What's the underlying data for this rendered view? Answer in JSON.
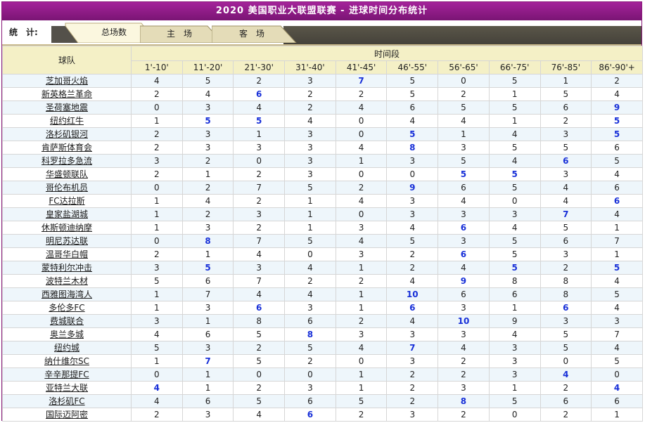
{
  "title": "2020 美国职业大联盟联赛 - 进球时间分布统计",
  "stats_label": "统　计:",
  "tabs": [
    {
      "label": "总场数",
      "active": true
    },
    {
      "label": "主　场",
      "active": false
    },
    {
      "label": "客　场",
      "active": false
    }
  ],
  "table": {
    "team_header": "球队",
    "period_header": "时间段",
    "periods": [
      "1'-10'",
      "11'-20'",
      "21'-30'",
      "31'-40'",
      "41'-45'",
      "46'-55'",
      "56'-65'",
      "66'-75'",
      "76'-85'",
      "86'-90'+"
    ],
    "rows": [
      {
        "team": "芝加哥火焰",
        "values": [
          4,
          5,
          2,
          3,
          7,
          5,
          0,
          5,
          1,
          2
        ],
        "highlight": [
          4
        ]
      },
      {
        "team": "新英格兰革命",
        "values": [
          2,
          4,
          6,
          2,
          2,
          5,
          2,
          1,
          5,
          4
        ],
        "highlight": [
          2
        ]
      },
      {
        "team": "圣荷塞地震",
        "values": [
          0,
          3,
          4,
          2,
          4,
          6,
          5,
          5,
          6,
          9
        ],
        "highlight": [
          9
        ]
      },
      {
        "team": "纽约红牛",
        "values": [
          1,
          5,
          5,
          4,
          0,
          4,
          4,
          1,
          2,
          5
        ],
        "highlight": [
          1,
          2,
          9
        ]
      },
      {
        "team": "洛杉矶银河",
        "values": [
          2,
          3,
          1,
          3,
          0,
          5,
          1,
          4,
          3,
          5
        ],
        "highlight": [
          5,
          9
        ]
      },
      {
        "team": "肯萨斯体育会",
        "values": [
          2,
          3,
          3,
          3,
          4,
          8,
          3,
          5,
          5,
          6
        ],
        "highlight": [
          5
        ]
      },
      {
        "team": "科罗拉多急流",
        "values": [
          3,
          2,
          0,
          3,
          1,
          3,
          5,
          4,
          6,
          5
        ],
        "highlight": [
          8
        ]
      },
      {
        "team": "华盛顿联队",
        "values": [
          2,
          1,
          2,
          3,
          0,
          0,
          5,
          5,
          3,
          4
        ],
        "highlight": [
          6,
          7
        ]
      },
      {
        "team": "哥伦布机员",
        "values": [
          0,
          2,
          7,
          5,
          2,
          9,
          6,
          5,
          4,
          6
        ],
        "highlight": [
          5
        ]
      },
      {
        "team": "FC达拉斯",
        "values": [
          1,
          4,
          2,
          1,
          4,
          3,
          4,
          0,
          4,
          6
        ],
        "highlight": [
          9
        ]
      },
      {
        "team": "皇家盐湖城",
        "values": [
          1,
          2,
          3,
          1,
          0,
          3,
          3,
          3,
          7,
          4
        ],
        "highlight": [
          8
        ]
      },
      {
        "team": "休斯顿迪纳摩",
        "values": [
          1,
          3,
          2,
          1,
          3,
          4,
          6,
          4,
          5,
          1
        ],
        "highlight": [
          6
        ]
      },
      {
        "team": "明尼苏达联",
        "values": [
          0,
          8,
          7,
          5,
          4,
          5,
          3,
          5,
          6,
          7
        ],
        "highlight": [
          1
        ]
      },
      {
        "team": "温哥华白帽",
        "values": [
          2,
          1,
          4,
          0,
          3,
          2,
          6,
          5,
          3,
          1
        ],
        "highlight": [
          6
        ]
      },
      {
        "team": "蒙特利尔冲击",
        "values": [
          3,
          5,
          3,
          4,
          1,
          2,
          4,
          5,
          2,
          5
        ],
        "highlight": [
          1,
          7,
          9
        ]
      },
      {
        "team": "波特兰木材",
        "values": [
          5,
          6,
          7,
          2,
          2,
          4,
          9,
          8,
          8,
          4
        ],
        "highlight": [
          6
        ]
      },
      {
        "team": "西雅图海湾人",
        "values": [
          1,
          7,
          4,
          4,
          1,
          10,
          6,
          6,
          8,
          5
        ],
        "highlight": [
          5
        ]
      },
      {
        "team": "多伦多FC",
        "values": [
          1,
          3,
          6,
          3,
          1,
          6,
          3,
          1,
          6,
          4
        ],
        "highlight": [
          2,
          5,
          8
        ]
      },
      {
        "team": "费城联合",
        "values": [
          3,
          1,
          8,
          6,
          2,
          4,
          10,
          9,
          3,
          3
        ],
        "highlight": [
          6
        ]
      },
      {
        "team": "奥兰多城",
        "values": [
          4,
          6,
          5,
          8,
          3,
          3,
          3,
          4,
          5,
          7
        ],
        "highlight": [
          3
        ]
      },
      {
        "team": "纽约城",
        "values": [
          5,
          3,
          2,
          5,
          4,
          7,
          4,
          3,
          5,
          4
        ],
        "highlight": [
          5
        ]
      },
      {
        "team": "纳什维尔SC",
        "values": [
          1,
          7,
          5,
          2,
          0,
          3,
          2,
          3,
          0,
          5
        ],
        "highlight": [
          1
        ]
      },
      {
        "team": "辛辛那提FC",
        "values": [
          0,
          1,
          0,
          0,
          1,
          2,
          2,
          3,
          4,
          0
        ],
        "highlight": [
          8
        ]
      },
      {
        "team": "亚特兰大联",
        "values": [
          4,
          1,
          2,
          3,
          1,
          2,
          3,
          1,
          2,
          4
        ],
        "highlight": [
          0,
          9
        ]
      },
      {
        "team": "洛杉矶FC",
        "values": [
          4,
          6,
          5,
          6,
          5,
          2,
          8,
          5,
          6,
          6
        ],
        "highlight": [
          6
        ]
      },
      {
        "team": "国际迈阿密",
        "values": [
          2,
          3,
          4,
          6,
          2,
          3,
          2,
          0,
          2,
          1
        ],
        "highlight": [
          3
        ]
      }
    ]
  },
  "colors": {
    "title_bg": "#8e1c88",
    "header_bg": "#f4f0c6",
    "row_alt": "#eef6fb",
    "highlight_text": "#1830d8",
    "tab_bar": "#4f4c42"
  }
}
